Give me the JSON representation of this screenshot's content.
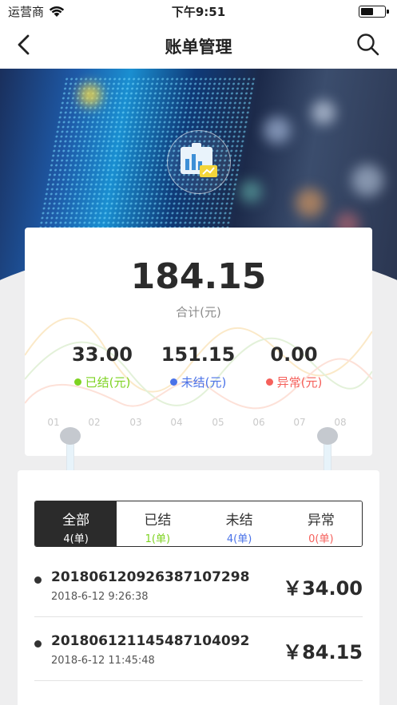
{
  "status_bar": {
    "carrier": "运营商",
    "time": "下午9:51",
    "battery_level": 0.55
  },
  "nav": {
    "title": "账单管理",
    "back_icon": "chevron-left-icon",
    "search_icon": "search-icon"
  },
  "summary": {
    "total": "184.15",
    "total_label": "合计(元)",
    "stats": [
      {
        "value": "33.00",
        "label": "已结(元)",
        "color": "#7ed321"
      },
      {
        "value": "151.15",
        "label": "未结(元)",
        "color": "#4a72e8"
      },
      {
        "value": "0.00",
        "label": "异常(元)",
        "color": "#f5605b"
      }
    ],
    "months": [
      "01",
      "02",
      "03",
      "04",
      "05",
      "06",
      "07",
      "08"
    ]
  },
  "tabs": [
    {
      "title": "全部",
      "count": "4(单)",
      "color": "#ffffff",
      "active": true
    },
    {
      "title": "已结",
      "count": "1(单)",
      "color": "#7ed321",
      "active": false
    },
    {
      "title": "未结",
      "count": "4(单)",
      "color": "#4a72e8",
      "active": false
    },
    {
      "title": "异常",
      "count": "0(单)",
      "color": "#f5605b",
      "active": false
    }
  ],
  "orders": [
    {
      "id": "20180612092638710729​8",
      "date": "2018-6-12 9:26:38",
      "amount": "￥34.00"
    },
    {
      "id": "20180612114548710409​2",
      "date": "2018-6-12 11:45:48",
      "amount": "￥84.15"
    }
  ]
}
